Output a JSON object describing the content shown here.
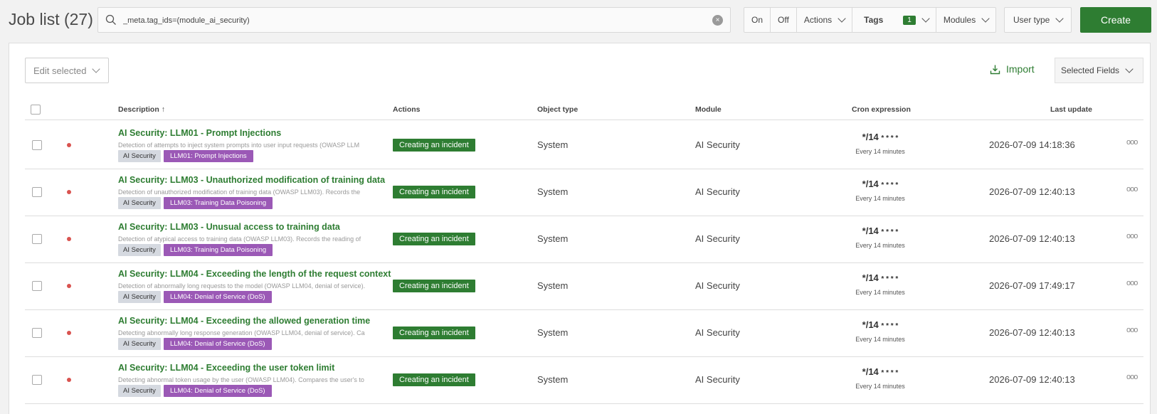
{
  "header": {
    "title": "Job list (27)",
    "search_value": "_meta.tag_ids=(module_ai_security)",
    "clear_label": "×",
    "on_label": "On",
    "off_label": "Off",
    "actions_label": "Actions",
    "tags_label": "Tags",
    "tags_count": "1",
    "modules_label": "Modules",
    "usertype_label": "User type",
    "create_label": "Create"
  },
  "toolbar": {
    "edit_selected": "Edit selected",
    "import_label": "Import",
    "selected_fields": "Selected Fields"
  },
  "table": {
    "columns": {
      "description": "Description",
      "actions": "Actions",
      "object_type": "Object type",
      "module": "Module",
      "cron": "Cron expression",
      "last_update": "Last update"
    },
    "rows": [
      {
        "name": "AI Security: LLM01 - Prompt Injections",
        "desc": "Detection of attempts to inject system prompts into user input requests (OWASP LLM",
        "tag1": "AI Security",
        "tag2": "LLM01: Prompt Injections",
        "action": "Creating an incident",
        "object_type": "System",
        "module": "AI Security",
        "cron": "*/14",
        "cron_rest": "* * * *",
        "cron_sub": "Every 14 minutes",
        "updated": "2026-07-09 14:18:36",
        "more": "ooo"
      },
      {
        "name": "AI Security: LLM03 - Unauthorized modification of training data",
        "desc": "Detection of unauthorized modification of training data (OWASP LLM03). Records the",
        "tag1": "AI Security",
        "tag2": "LLM03: Training Data Poisoning",
        "action": "Creating an incident",
        "object_type": "System",
        "module": "AI Security",
        "cron": "*/14",
        "cron_rest": "* * * *",
        "cron_sub": "Every 14 minutes",
        "updated": "2026-07-09 12:40:13",
        "more": "ooo"
      },
      {
        "name": "AI Security: LLM03 - Unusual access to training data",
        "desc": "Detection of atypical access to training data (OWASP LLM03). Records the reading of",
        "tag1": "AI Security",
        "tag2": "LLM03: Training Data Poisoning",
        "action": "Creating an incident",
        "object_type": "System",
        "module": "AI Security",
        "cron": "*/14",
        "cron_rest": "* * * *",
        "cron_sub": "Every 14 minutes",
        "updated": "2026-07-09 12:40:13",
        "more": "ooo"
      },
      {
        "name": "AI Security: LLM04 - Exceeding the length of the request context",
        "desc": "Detection of abnormally long requests to the model (OWASP LLM04, denial of service).",
        "tag1": "AI Security",
        "tag2": "LLM04: Denial of Service (DoS)",
        "action": "Creating an incident",
        "object_type": "System",
        "module": "AI Security",
        "cron": "*/14",
        "cron_rest": "* * * *",
        "cron_sub": "Every 14 minutes",
        "updated": "2026-07-09 17:49:17",
        "more": "ooo"
      },
      {
        "name": "AI Security: LLM04 - Exceeding the allowed generation time",
        "desc": "Detecting abnormally long response generation (OWASP LLM04, denial of service). Ca",
        "tag1": "AI Security",
        "tag2": "LLM04: Denial of Service (DoS)",
        "action": "Creating an incident",
        "object_type": "System",
        "module": "AI Security",
        "cron": "*/14",
        "cron_rest": "* * * *",
        "cron_sub": "Every 14 minutes",
        "updated": "2026-07-09 12:40:13",
        "more": "ooo"
      },
      {
        "name": "AI Security: LLM04 - Exceeding the user token limit",
        "desc": "Detecting abnormal token usage by the user (OWASP LLM04). Compares the user's to",
        "tag1": "AI Security",
        "tag2": "LLM04: Denial of Service (DoS)",
        "action": "Creating an incident",
        "object_type": "System",
        "module": "AI Security",
        "cron": "*/14",
        "cron_rest": "* * * *",
        "cron_sub": "Every 14 minutes",
        "updated": "2026-07-09 12:40:13",
        "more": "ooo"
      }
    ]
  }
}
